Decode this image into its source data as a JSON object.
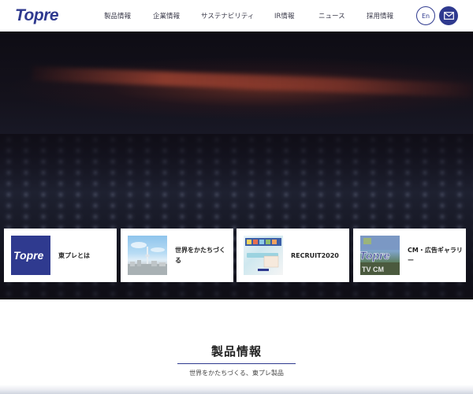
{
  "header": {
    "logo_text": "Topre",
    "nav": [
      {
        "label": "製品情報"
      },
      {
        "label": "企業情報"
      },
      {
        "label": "サステナビリティ"
      },
      {
        "label": "IR情報"
      },
      {
        "label": "ニュース"
      },
      {
        "label": "採用情報"
      }
    ],
    "lang_label": "En",
    "mail_icon": "mail-icon"
  },
  "colors": {
    "brand": "#2f3a8f",
    "hero_bg": "#14121c"
  },
  "cards": [
    {
      "label": "東プレとは",
      "thumb_icon": "topre-logo-image"
    },
    {
      "label": "世界をかたちづくる",
      "thumb_icon": "city-skyline-image"
    },
    {
      "label": "RECRUIT2020",
      "thumb_icon": "recruit-brochure-image"
    },
    {
      "label": "CM・広告ギャラリー",
      "thumb_icon": "cm-gallery-image"
    }
  ],
  "section": {
    "title": "製品情報",
    "subtitle": "世界をかたちづくる、東プレ製品"
  }
}
